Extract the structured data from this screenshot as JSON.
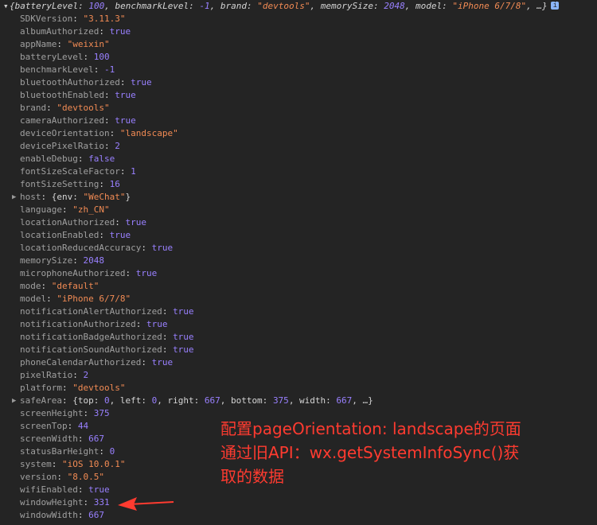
{
  "console": {
    "summary": {
      "prefix": "{",
      "parts": [
        {
          "key": "batteryLevel: ",
          "value": "100",
          "type": "num"
        },
        {
          "key": ", benchmarkLevel: ",
          "value": "-1",
          "type": "num"
        },
        {
          "key": ", brand: ",
          "value": "\"devtools\"",
          "type": "str"
        },
        {
          "key": ", memorySize: ",
          "value": "2048",
          "type": "num"
        },
        {
          "key": ", model: ",
          "value": "\"iPhone 6/7/8\"",
          "type": "str"
        }
      ],
      "suffix": ", …}"
    },
    "properties": [
      {
        "key": "SDKVersion",
        "value": "\"3.11.3\"",
        "type": "str"
      },
      {
        "key": "albumAuthorized",
        "value": "true",
        "type": "bool"
      },
      {
        "key": "appName",
        "value": "\"weixin\"",
        "type": "str"
      },
      {
        "key": "batteryLevel",
        "value": "100",
        "type": "num"
      },
      {
        "key": "benchmarkLevel",
        "value": "-1",
        "type": "num"
      },
      {
        "key": "bluetoothAuthorized",
        "value": "true",
        "type": "bool"
      },
      {
        "key": "bluetoothEnabled",
        "value": "true",
        "type": "bool"
      },
      {
        "key": "brand",
        "value": "\"devtools\"",
        "type": "str"
      },
      {
        "key": "cameraAuthorized",
        "value": "true",
        "type": "bool"
      },
      {
        "key": "deviceOrientation",
        "value": "\"landscape\"",
        "type": "str"
      },
      {
        "key": "devicePixelRatio",
        "value": "2",
        "type": "num"
      },
      {
        "key": "enableDebug",
        "value": "false",
        "type": "bool"
      },
      {
        "key": "fontSizeScaleFactor",
        "value": "1",
        "type": "num"
      },
      {
        "key": "fontSizeSetting",
        "value": "16",
        "type": "num"
      },
      {
        "key": "host",
        "type": "obj",
        "expandable": true,
        "obj_parts": [
          {
            "t": "plain",
            "v": "{env: "
          },
          {
            "t": "str",
            "v": "\"WeChat\""
          },
          {
            "t": "plain",
            "v": "}"
          }
        ]
      },
      {
        "key": "language",
        "value": "\"zh_CN\"",
        "type": "str"
      },
      {
        "key": "locationAuthorized",
        "value": "true",
        "type": "bool"
      },
      {
        "key": "locationEnabled",
        "value": "true",
        "type": "bool"
      },
      {
        "key": "locationReducedAccuracy",
        "value": "true",
        "type": "bool"
      },
      {
        "key": "memorySize",
        "value": "2048",
        "type": "num"
      },
      {
        "key": "microphoneAuthorized",
        "value": "true",
        "type": "bool"
      },
      {
        "key": "mode",
        "value": "\"default\"",
        "type": "str"
      },
      {
        "key": "model",
        "value": "\"iPhone 6/7/8\"",
        "type": "str"
      },
      {
        "key": "notificationAlertAuthorized",
        "value": "true",
        "type": "bool"
      },
      {
        "key": "notificationAuthorized",
        "value": "true",
        "type": "bool"
      },
      {
        "key": "notificationBadgeAuthorized",
        "value": "true",
        "type": "bool"
      },
      {
        "key": "notificationSoundAuthorized",
        "value": "true",
        "type": "bool"
      },
      {
        "key": "phoneCalendarAuthorized",
        "value": "true",
        "type": "bool"
      },
      {
        "key": "pixelRatio",
        "value": "2",
        "type": "num"
      },
      {
        "key": "platform",
        "value": "\"devtools\"",
        "type": "str"
      },
      {
        "key": "safeArea",
        "type": "obj",
        "expandable": true,
        "obj_parts": [
          {
            "t": "plain",
            "v": "{top: "
          },
          {
            "t": "num",
            "v": "0"
          },
          {
            "t": "plain",
            "v": ", left: "
          },
          {
            "t": "num",
            "v": "0"
          },
          {
            "t": "plain",
            "v": ", right: "
          },
          {
            "t": "num",
            "v": "667"
          },
          {
            "t": "plain",
            "v": ", bottom: "
          },
          {
            "t": "num",
            "v": "375"
          },
          {
            "t": "plain",
            "v": ", width: "
          },
          {
            "t": "num",
            "v": "667"
          },
          {
            "t": "plain",
            "v": ", …}"
          }
        ]
      },
      {
        "key": "screenHeight",
        "value": "375",
        "type": "num"
      },
      {
        "key": "screenTop",
        "value": "44",
        "type": "num"
      },
      {
        "key": "screenWidth",
        "value": "667",
        "type": "num"
      },
      {
        "key": "statusBarHeight",
        "value": "0",
        "type": "num"
      },
      {
        "key": "system",
        "value": "\"iOS 10.0.1\"",
        "type": "str"
      },
      {
        "key": "version",
        "value": "\"8.0.5\"",
        "type": "str"
      },
      {
        "key": "wifiEnabled",
        "value": "true",
        "type": "bool"
      },
      {
        "key": "windowHeight",
        "value": "331",
        "type": "num"
      },
      {
        "key": "windowWidth",
        "value": "667",
        "type": "num"
      }
    ]
  },
  "annotation": {
    "text_lines": [
      "配置pageOrientation: landscape的页面",
      "通过旧API：wx.getSystemInfoSync()获",
      "取的数据"
    ]
  },
  "colors": {
    "background": "#242424",
    "key": "#a0a0a0",
    "number": "#9980ff",
    "string": "#f28b54",
    "annotation": "#ff3b30"
  },
  "icons": {
    "summary_toggle": "triangle-down-icon",
    "expander": "triangle-right-icon",
    "info": "info-badge-icon",
    "pointer": "red-arrow-icon"
  }
}
